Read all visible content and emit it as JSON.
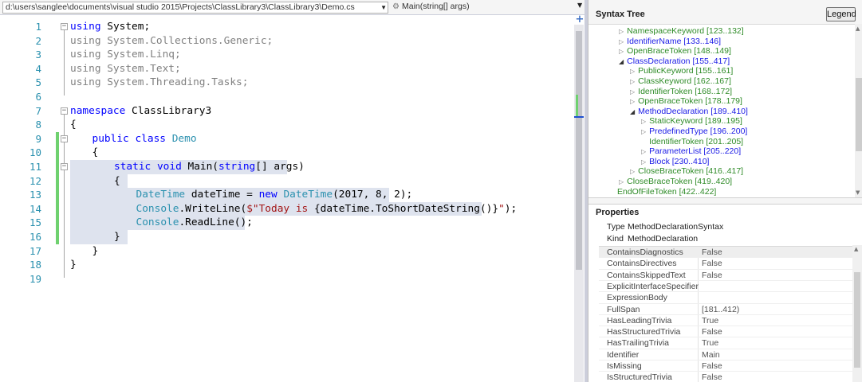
{
  "editor": {
    "file_path": "d:\\users\\sanglee\\documents\\visual studio 2015\\Projects\\ClassLibrary3\\ClassLibrary3\\Demo.cs",
    "member": "Main(string[] args)",
    "lines": [
      {
        "n": "1",
        "indent": 0,
        "tokens": [
          {
            "t": "using",
            "c": "kw"
          },
          {
            "t": " System;",
            "c": ""
          }
        ]
      },
      {
        "n": "2",
        "indent": 0,
        "tokens": [
          {
            "t": "using System.Collections.Generic;",
            "c": "fade"
          }
        ]
      },
      {
        "n": "3",
        "indent": 0,
        "tokens": [
          {
            "t": "using System.Linq;",
            "c": "fade"
          }
        ]
      },
      {
        "n": "4",
        "indent": 0,
        "tokens": [
          {
            "t": "using System.Text;",
            "c": "fade"
          }
        ]
      },
      {
        "n": "5",
        "indent": 0,
        "tokens": [
          {
            "t": "using System.Threading.Tasks;",
            "c": "fade"
          }
        ]
      },
      {
        "n": "6",
        "indent": 0,
        "tokens": []
      },
      {
        "n": "7",
        "indent": 0,
        "tokens": [
          {
            "t": "namespace",
            "c": "kw"
          },
          {
            "t": " ClassLibrary3",
            "c": ""
          }
        ]
      },
      {
        "n": "8",
        "indent": 0,
        "tokens": [
          {
            "t": "{",
            "c": ""
          }
        ]
      },
      {
        "n": "9",
        "indent": 1,
        "tokens": [
          {
            "t": "public",
            "c": "kw"
          },
          {
            "t": " ",
            "c": ""
          },
          {
            "t": "class",
            "c": "kw"
          },
          {
            "t": " ",
            "c": ""
          },
          {
            "t": "Demo",
            "c": "ty"
          }
        ]
      },
      {
        "n": "10",
        "indent": 1,
        "tokens": [
          {
            "t": "{",
            "c": ""
          }
        ]
      },
      {
        "n": "11",
        "indent": 2,
        "tokens": [
          {
            "t": "static",
            "c": "kw"
          },
          {
            "t": " ",
            "c": ""
          },
          {
            "t": "void",
            "c": "kw"
          },
          {
            "t": " Main(",
            "c": ""
          },
          {
            "t": "string",
            "c": "kw"
          },
          {
            "t": "[] args)",
            "c": ""
          }
        ]
      },
      {
        "n": "12",
        "indent": 2,
        "tokens": [
          {
            "t": "{",
            "c": ""
          }
        ]
      },
      {
        "n": "13",
        "indent": 3,
        "tokens": [
          {
            "t": "DateTime",
            "c": "ty"
          },
          {
            "t": " dateTime = ",
            "c": ""
          },
          {
            "t": "new",
            "c": "kw"
          },
          {
            "t": " ",
            "c": ""
          },
          {
            "t": "DateTime",
            "c": "ty"
          },
          {
            "t": "(2017, 8, 2);",
            "c": ""
          }
        ]
      },
      {
        "n": "14",
        "indent": 3,
        "tokens": [
          {
            "t": "Console",
            "c": "ty"
          },
          {
            "t": ".WriteLine(",
            "c": ""
          },
          {
            "t": "$\"Today is ",
            "c": "st"
          },
          {
            "t": "{dateTime.ToShortDateString()}",
            "c": ""
          },
          {
            "t": "\"",
            "c": "st"
          },
          {
            "t": ");",
            "c": ""
          }
        ]
      },
      {
        "n": "15",
        "indent": 3,
        "tokens": [
          {
            "t": "Console",
            "c": "ty"
          },
          {
            "t": ".ReadLine();",
            "c": ""
          }
        ]
      },
      {
        "n": "16",
        "indent": 2,
        "tokens": [
          {
            "t": "}",
            "c": ""
          }
        ]
      },
      {
        "n": "17",
        "indent": 1,
        "tokens": [
          {
            "t": "}",
            "c": ""
          }
        ]
      },
      {
        "n": "18",
        "indent": 0,
        "tokens": [
          {
            "t": "}",
            "c": ""
          }
        ]
      },
      {
        "n": "19",
        "indent": 0,
        "tokens": []
      }
    ]
  },
  "syntax_tree": {
    "title": "Syntax Tree",
    "legend_label": "Legend",
    "nodes": [
      {
        "label": "NamespaceKeyword [123..132]",
        "depth": 1,
        "state": "closed",
        "color": "green"
      },
      {
        "label": "IdentifierName [133..146]",
        "depth": 1,
        "state": "closed",
        "color": "blue"
      },
      {
        "label": "OpenBraceToken [148..149]",
        "depth": 1,
        "state": "closed",
        "color": "green"
      },
      {
        "label": "ClassDeclaration [155..417]",
        "depth": 1,
        "state": "open",
        "color": "blue"
      },
      {
        "label": "PublicKeyword [155..161]",
        "depth": 2,
        "state": "closed",
        "color": "green"
      },
      {
        "label": "ClassKeyword [162..167]",
        "depth": 2,
        "state": "closed",
        "color": "green"
      },
      {
        "label": "IdentifierToken [168..172]",
        "depth": 2,
        "state": "closed",
        "color": "green"
      },
      {
        "label": "OpenBraceToken [178..179]",
        "depth": 2,
        "state": "closed",
        "color": "green"
      },
      {
        "label": "MethodDeclaration [189..410]",
        "depth": 2,
        "state": "open",
        "color": "blue"
      },
      {
        "label": "StaticKeyword [189..195]",
        "depth": 3,
        "state": "closed",
        "color": "green"
      },
      {
        "label": "PredefinedType [196..200]",
        "depth": 3,
        "state": "closed",
        "color": "blue"
      },
      {
        "label": "IdentifierToken [201..205]",
        "depth": 3,
        "state": "leaf",
        "color": "green"
      },
      {
        "label": "ParameterList [205..220]",
        "depth": 3,
        "state": "closed",
        "color": "blue"
      },
      {
        "label": "Block [230..410]",
        "depth": 3,
        "state": "closed",
        "color": "blue"
      },
      {
        "label": "CloseBraceToken [416..417]",
        "depth": 2,
        "state": "closed",
        "color": "green"
      },
      {
        "label": "CloseBraceToken [419..420]",
        "depth": 1,
        "state": "closed",
        "color": "green"
      },
      {
        "label": "EndOfFileToken [422..422]",
        "depth": 0,
        "state": "leaf",
        "color": "green"
      }
    ]
  },
  "properties": {
    "title": "Properties",
    "type_key": "Type",
    "type_value": "MethodDeclarationSyntax",
    "kind_key": "Kind",
    "kind_value": "MethodDeclaration",
    "rows": [
      {
        "name": "ContainsDiagnostics",
        "value": "False"
      },
      {
        "name": "ContainsDirectives",
        "value": "False"
      },
      {
        "name": "ContainsSkippedText",
        "value": "False"
      },
      {
        "name": "ExplicitInterfaceSpecifier",
        "value": ""
      },
      {
        "name": "ExpressionBody",
        "value": ""
      },
      {
        "name": "FullSpan",
        "value": "[181..412)"
      },
      {
        "name": "HasLeadingTrivia",
        "value": "True"
      },
      {
        "name": "HasStructuredTrivia",
        "value": "False"
      },
      {
        "name": "HasTrailingTrivia",
        "value": "True"
      },
      {
        "name": "Identifier",
        "value": "Main"
      },
      {
        "name": "IsMissing",
        "value": "False"
      },
      {
        "name": "IsStructuredTrivia",
        "value": "False"
      }
    ]
  },
  "colors": {
    "keyword": "#0000ff",
    "type": "#2b91af",
    "string": "#a31515",
    "tree_token": "#2e8b27",
    "tree_node": "#1a1ae6",
    "selection": "#dee3ee",
    "change_bar": "#6fd16f"
  }
}
